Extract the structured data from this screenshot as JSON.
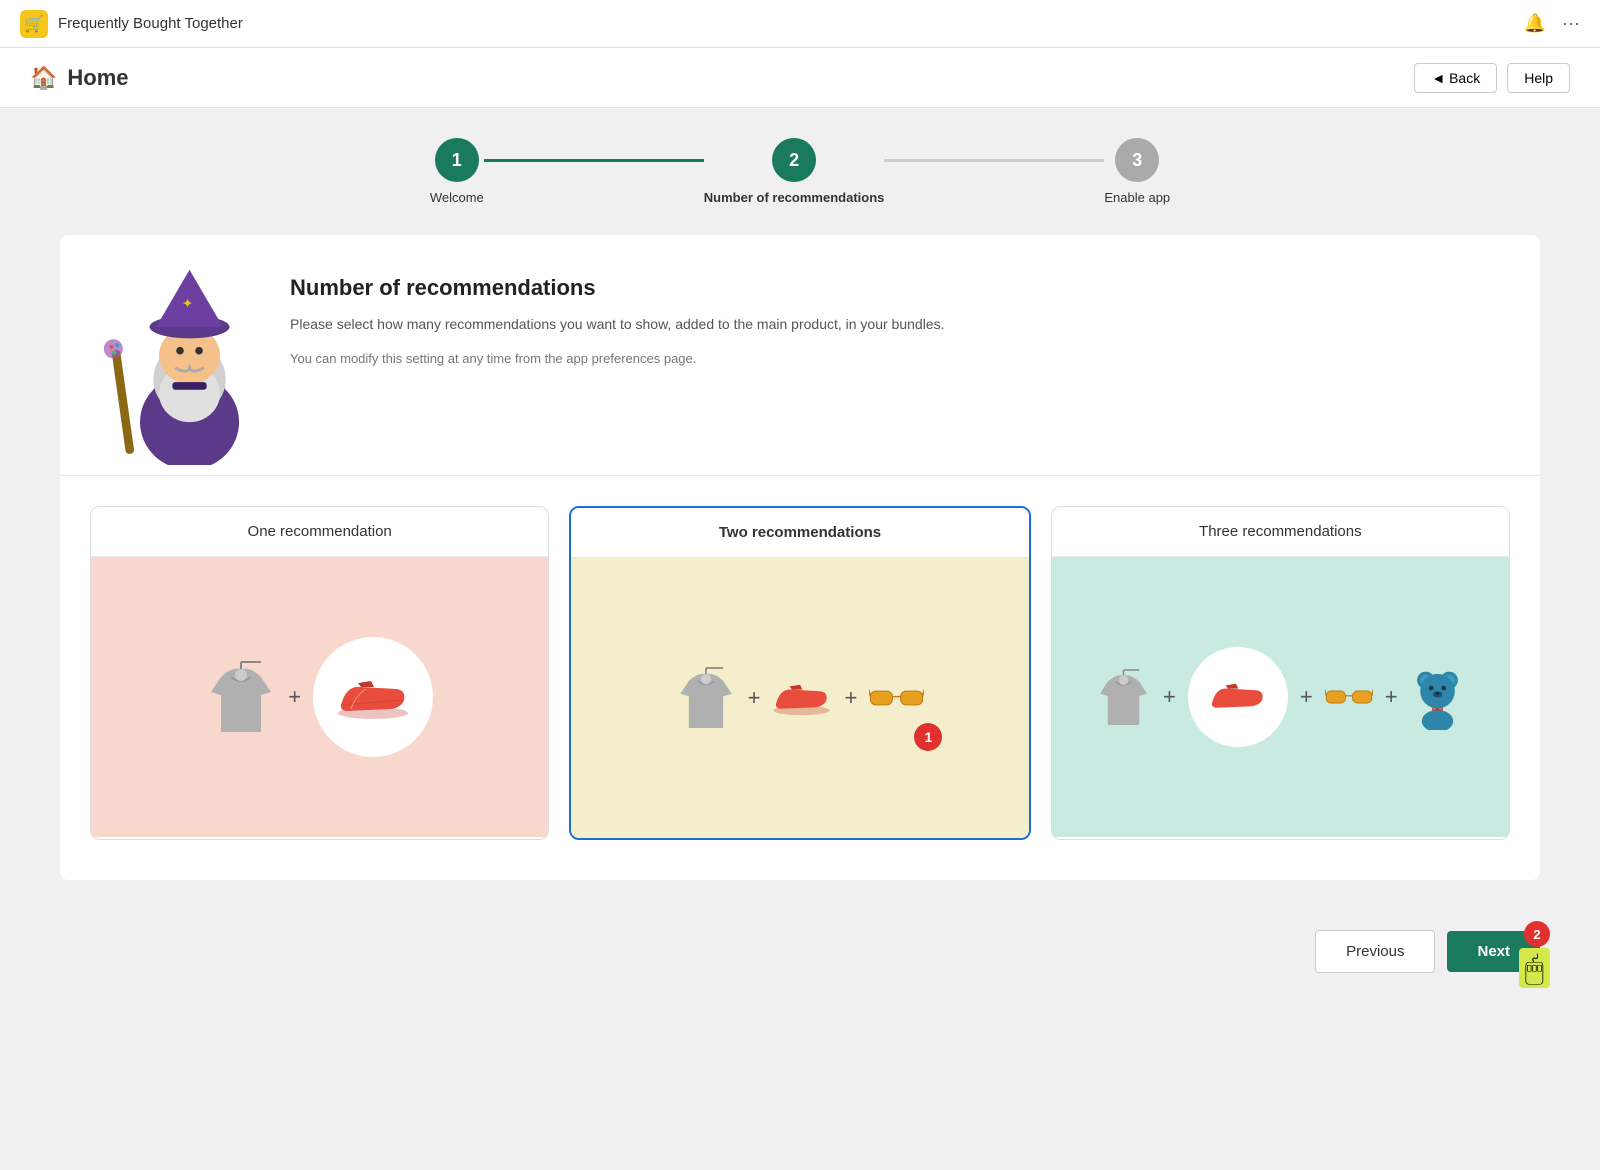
{
  "app": {
    "title": "Frequently Bought Together",
    "icon": "🛒"
  },
  "topbar": {
    "bell_icon": "🔔",
    "more_icon": "···"
  },
  "home": {
    "icon": "🏠",
    "title": "Home",
    "back_label": "◄ Back",
    "help_label": "Help"
  },
  "stepper": {
    "steps": [
      {
        "number": "1",
        "label": "Welcome",
        "state": "active"
      },
      {
        "number": "2",
        "label": "Number of recommendations",
        "state": "current"
      },
      {
        "number": "3",
        "label": "Enable app",
        "state": "inactive"
      }
    ]
  },
  "info": {
    "title": "Number of recommendations",
    "desc1": "Please select how many recommendations you want to show, added to the main product, in your bundles.",
    "desc2": "You can modify this setting at any time from the app preferences page."
  },
  "recommendations": {
    "cards": [
      {
        "label": "One recommendation",
        "selected": false,
        "color": "pink",
        "items": [
          "hoodie",
          "shoe"
        ]
      },
      {
        "label": "Two recommendations",
        "selected": true,
        "color": "yellow",
        "items": [
          "hoodie",
          "shoe",
          "glasses"
        ]
      },
      {
        "label": "Three recommendations",
        "selected": false,
        "color": "teal",
        "items": [
          "hoodie",
          "shoe",
          "glasses",
          "bear"
        ]
      }
    ]
  },
  "footer": {
    "previous_label": "Previous",
    "next_label": "Next",
    "next_badge": "2",
    "selected_badge": "1"
  }
}
